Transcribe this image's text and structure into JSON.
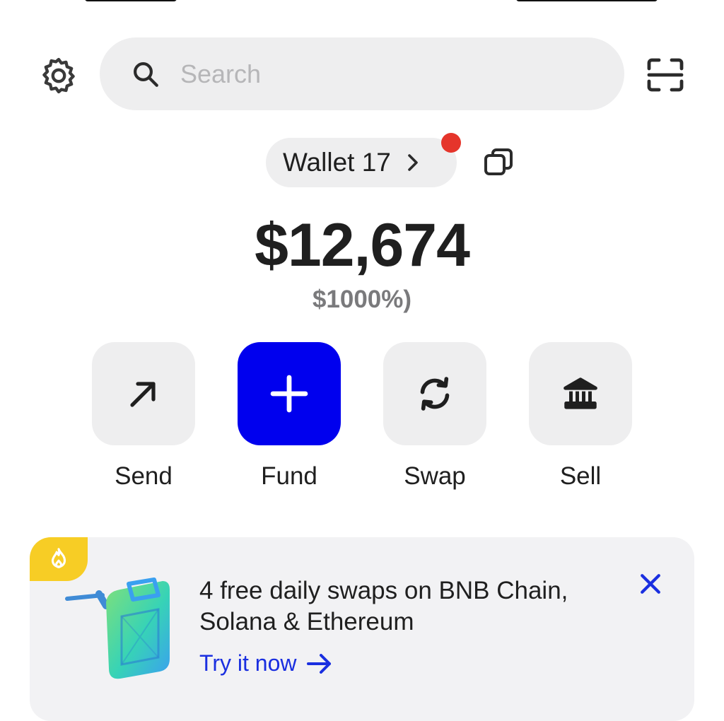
{
  "header": {
    "settings_icon": "gear-icon",
    "search": {
      "placeholder": "Search",
      "value": ""
    },
    "scan_icon": "scan-icon"
  },
  "wallet": {
    "name": "Wallet 17",
    "has_notification": true,
    "notification_color": "#e5352b"
  },
  "balance": {
    "amount": "$12,674",
    "change": "$1000%)"
  },
  "actions": [
    {
      "label": "Send",
      "icon": "arrow-up-right-icon"
    },
    {
      "label": "Fund",
      "icon": "plus-icon",
      "primary_color": "#0000ee"
    },
    {
      "label": "Swap",
      "icon": "swap-icon"
    },
    {
      "label": "Sell",
      "icon": "bank-icon"
    }
  ],
  "promo": {
    "badge_icon": "flame-icon",
    "badge_color": "#f7cd25",
    "title": "4 free daily swaps on BNB Chain, Solana & Ethereum",
    "cta": "Try it now",
    "cta_color": "#1a2fe0",
    "close_icon": "close-icon"
  }
}
